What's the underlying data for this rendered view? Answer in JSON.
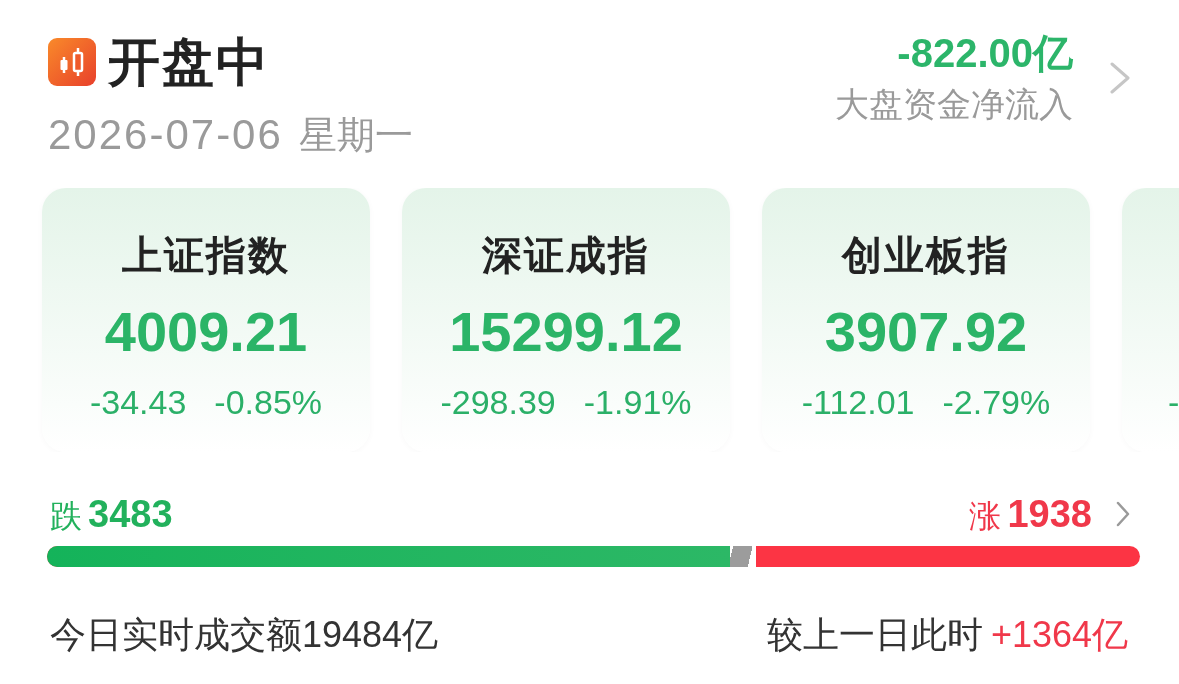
{
  "header": {
    "title": "开盘中",
    "date": "2026-07-06",
    "weekday": "星期一"
  },
  "net_inflow": {
    "value": "-822.00亿",
    "label": "大盘资金净流入"
  },
  "indices": [
    {
      "name": "上证指数",
      "value": "4009.21",
      "change": "-34.43",
      "percent": "-0.85%"
    },
    {
      "name": "深证成指",
      "value": "15299.12",
      "change": "-298.39",
      "percent": "-1.91%"
    },
    {
      "name": "创业板指",
      "value": "3907.92",
      "change": "-112.01",
      "percent": "-2.79%"
    },
    {
      "change": "-"
    }
  ],
  "breadth": {
    "fall_label": "跌",
    "fall_count": "3483",
    "rise_label": "涨",
    "rise_count": "1938",
    "level": 0.625
  },
  "turnover": {
    "label": "今日实时成交额",
    "value": "19484亿",
    "compare_label": "较上一日此时",
    "compare_value": "+1364亿"
  }
}
